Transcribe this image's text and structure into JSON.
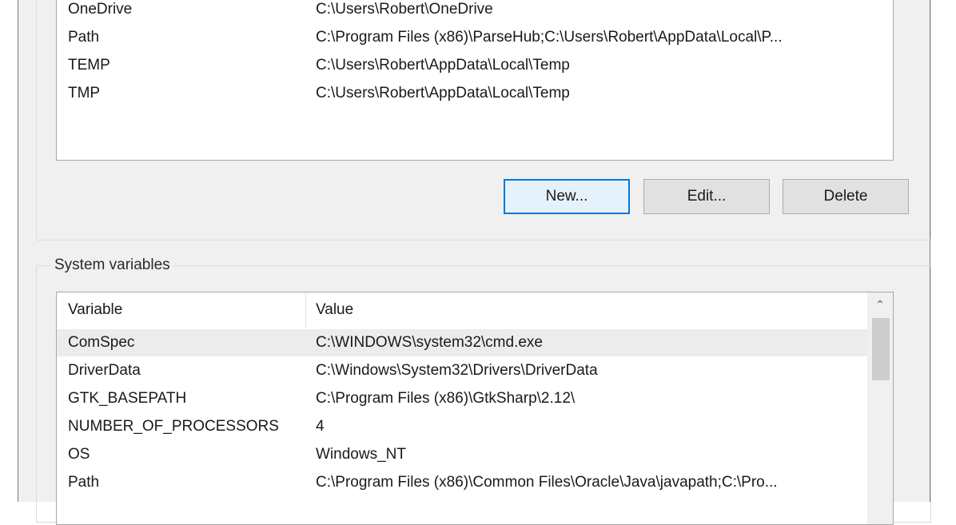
{
  "user_variables": {
    "rows": [
      {
        "name": "OneDrive",
        "value": "C:\\Users\\Robert\\OneDrive"
      },
      {
        "name": "Path",
        "value": "C:\\Program Files (x86)\\ParseHub;C:\\Users\\Robert\\AppData\\Local\\P..."
      },
      {
        "name": "TEMP",
        "value": "C:\\Users\\Robert\\AppData\\Local\\Temp"
      },
      {
        "name": "TMP",
        "value": "C:\\Users\\Robert\\AppData\\Local\\Temp"
      }
    ],
    "buttons": {
      "new": "New...",
      "edit": "Edit...",
      "delete": "Delete"
    }
  },
  "system_variables": {
    "title": "System variables",
    "columns": {
      "variable": "Variable",
      "value": "Value"
    },
    "rows": [
      {
        "name": "ComSpec",
        "value": "C:\\WINDOWS\\system32\\cmd.exe",
        "selected": true
      },
      {
        "name": "DriverData",
        "value": "C:\\Windows\\System32\\Drivers\\DriverData"
      },
      {
        "name": "GTK_BASEPATH",
        "value": "C:\\Program Files (x86)\\GtkSharp\\2.12\\"
      },
      {
        "name": "NUMBER_OF_PROCESSORS",
        "value": "4"
      },
      {
        "name": "OS",
        "value": "Windows_NT"
      },
      {
        "name": "Path",
        "value": "C:\\Program Files (x86)\\Common Files\\Oracle\\Java\\javapath;C:\\Pro..."
      }
    ]
  },
  "icons": {
    "scroll_up": "chevron-up-icon"
  }
}
